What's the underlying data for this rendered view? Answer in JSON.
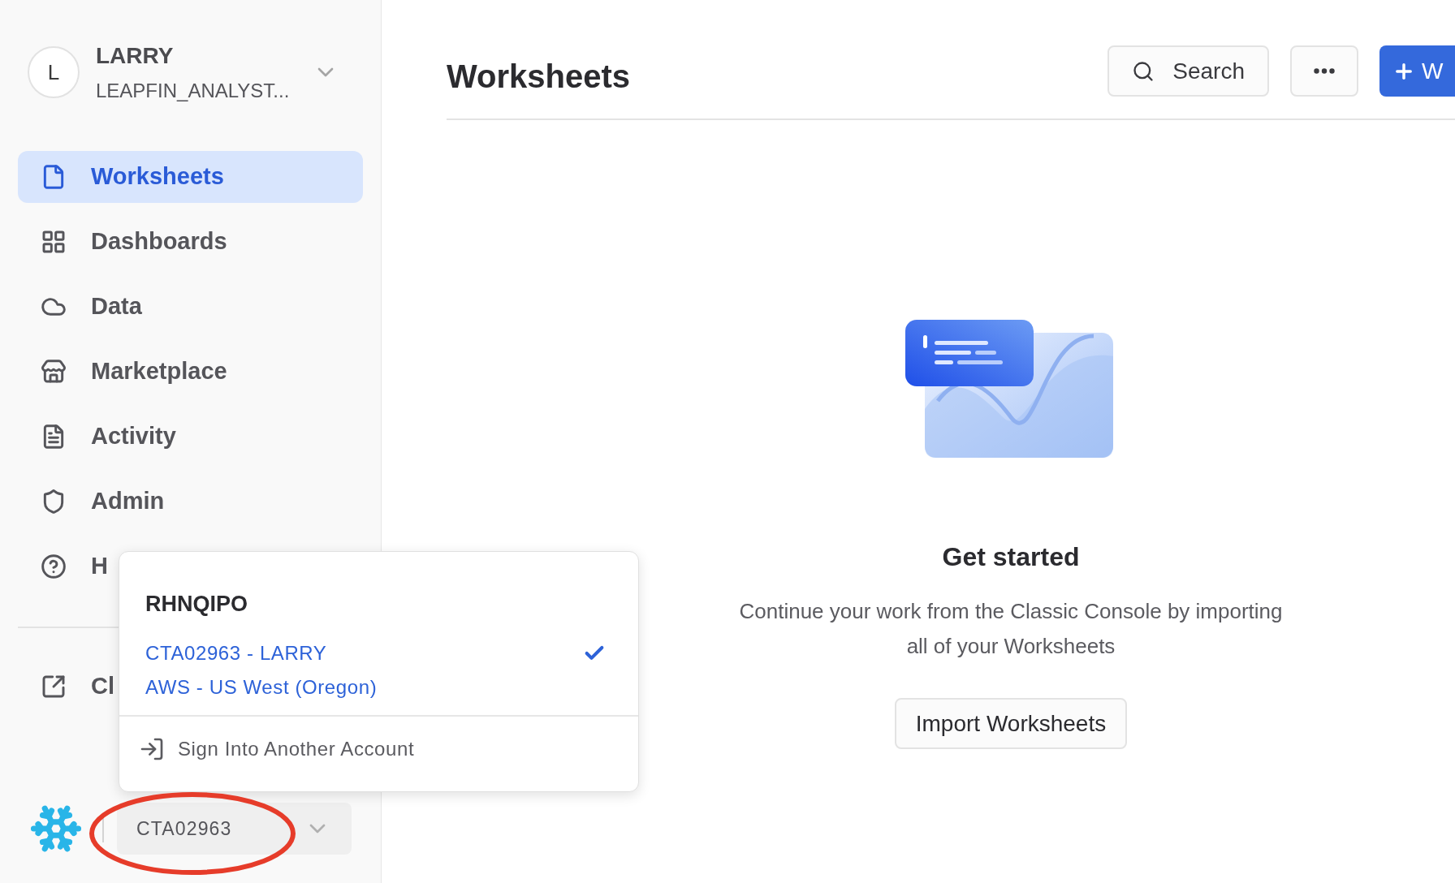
{
  "account": {
    "avatar": "L",
    "name": "LARRY",
    "role": "LEAPFIN_ANALYST..."
  },
  "nav": [
    {
      "label": "Worksheets",
      "selected": true
    },
    {
      "label": "Dashboards",
      "selected": false
    },
    {
      "label": "Data",
      "selected": false
    },
    {
      "label": "Marketplace",
      "selected": false
    },
    {
      "label": "Activity",
      "selected": false
    },
    {
      "label": "Admin",
      "selected": false
    },
    {
      "label": "H",
      "selected": false
    }
  ],
  "classic_link": "Cl",
  "account_chip": "CTA02963",
  "menu": {
    "organization": "RHNQIPO",
    "accounts": [
      {
        "label": "CTA02963 - LARRY",
        "region": "AWS - US West (Oregon)",
        "selected": true
      }
    ],
    "action": "Sign Into Another Account"
  },
  "header": {
    "title": "Worksheets",
    "search": "Search",
    "new_button": "W"
  },
  "empty_state": {
    "title": "Get started",
    "text": "Continue your work from the Classic Console by importing all of your Worksheets",
    "button": "Import Worksheets"
  }
}
